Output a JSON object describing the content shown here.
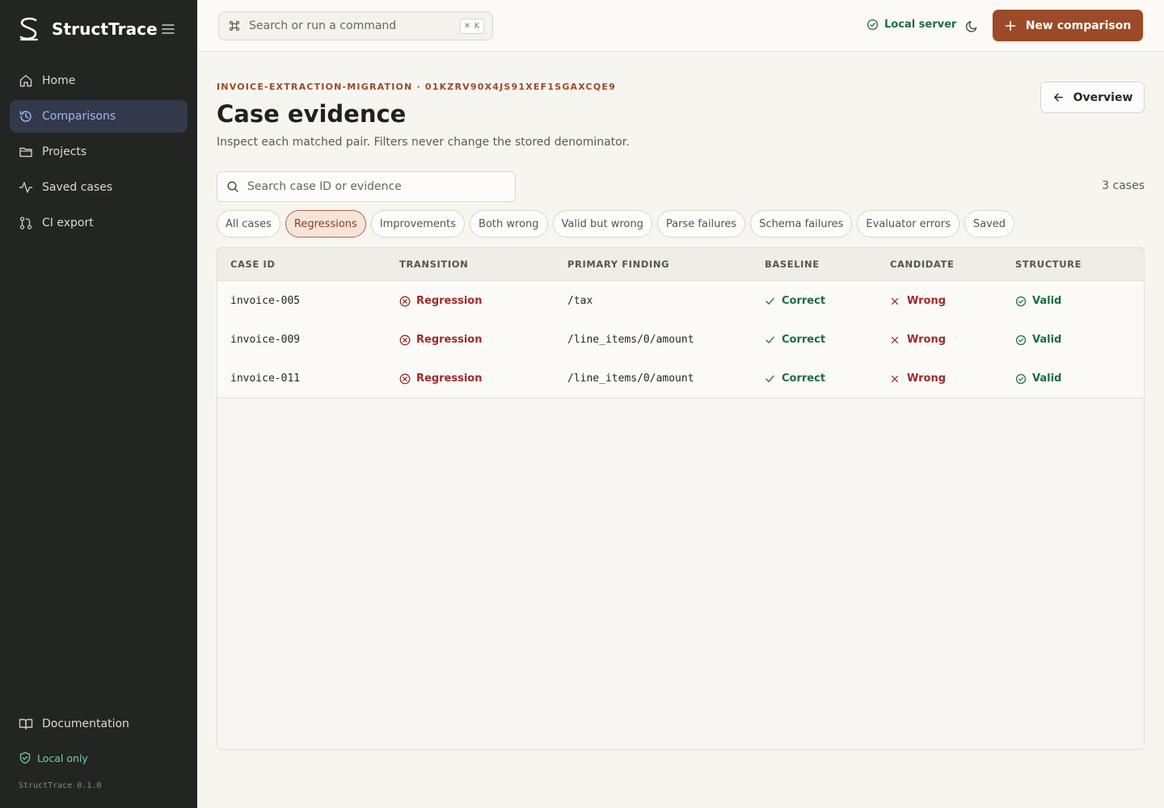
{
  "app": {
    "name": "StructTrace",
    "version": "StructTrace 0.1.0"
  },
  "sidebar": {
    "items": [
      {
        "label": "Home",
        "icon": "home-icon"
      },
      {
        "label": "Comparisons",
        "icon": "history-icon",
        "active": true
      },
      {
        "label": "Projects",
        "icon": "folder-icon"
      },
      {
        "label": "Saved cases",
        "icon": "activity-icon"
      },
      {
        "label": "CI export",
        "icon": "git-pull-request-icon"
      }
    ],
    "documentation": "Documentation",
    "local_only": "Local only"
  },
  "topbar": {
    "search_placeholder": "Search or run a command",
    "shortcut": "⌘ K",
    "server_status": "Local server",
    "new_comparison": "New comparison"
  },
  "page": {
    "breadcrumb": "INVOICE-EXTRACTION-MIGRATION · 01KZRV90X4JS91XEF1SGAXCQE9",
    "title": "Case evidence",
    "description": "Inspect each matched pair. Filters never change the stored denominator.",
    "overview_button": "Overview",
    "search_placeholder": "Search case ID or evidence",
    "case_count": "3 cases"
  },
  "filters": [
    {
      "label": "All cases",
      "active": false
    },
    {
      "label": "Regressions",
      "active": true
    },
    {
      "label": "Improvements",
      "active": false
    },
    {
      "label": "Both wrong",
      "active": false
    },
    {
      "label": "Valid but wrong",
      "active": false
    },
    {
      "label": "Parse failures",
      "active": false
    },
    {
      "label": "Schema failures",
      "active": false
    },
    {
      "label": "Evaluator errors",
      "active": false
    },
    {
      "label": "Saved",
      "active": false
    }
  ],
  "table": {
    "columns": [
      "CASE ID",
      "TRANSITION",
      "PRIMARY FINDING",
      "BASELINE",
      "CANDIDATE",
      "STRUCTURE"
    ],
    "rows": [
      {
        "case_id": "invoice-005",
        "transition": "Regression",
        "finding": "/tax",
        "baseline": "Correct",
        "candidate": "Wrong",
        "structure": "Valid"
      },
      {
        "case_id": "invoice-009",
        "transition": "Regression",
        "finding": "/line_items/0/amount",
        "baseline": "Correct",
        "candidate": "Wrong",
        "structure": "Valid"
      },
      {
        "case_id": "invoice-011",
        "transition": "Regression",
        "finding": "/line_items/0/amount",
        "baseline": "Correct",
        "candidate": "Wrong",
        "structure": "Valid"
      }
    ]
  },
  "colors": {
    "sidebar_bg": "#232523",
    "accent": "#9c4a27",
    "success": "#1e6b45",
    "danger": "#9e2a2a",
    "active_nav": "#9db6f3"
  }
}
